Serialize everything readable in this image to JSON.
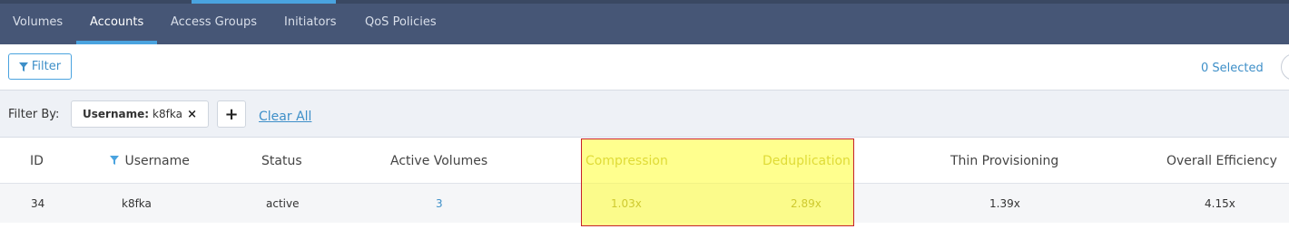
{
  "nav": {
    "tabs": [
      {
        "label": "Volumes"
      },
      {
        "label": "Accounts",
        "active": true
      },
      {
        "label": "Access Groups"
      },
      {
        "label": "Initiators"
      },
      {
        "label": "QoS Policies"
      }
    ],
    "accent_color": "#4aa3df",
    "background_color": "#465676"
  },
  "toolbar": {
    "filter_label": "Filter",
    "filter_icon": "funnel-icon",
    "selected_text": "0 Selected"
  },
  "filter_bar": {
    "label": "Filter By:",
    "chip": {
      "key": "Username:",
      "value": "k8fka",
      "remove": "×"
    },
    "add_label": "+",
    "clear_label": "Clear All"
  },
  "table": {
    "columns": [
      {
        "label": "ID"
      },
      {
        "label": "Username",
        "filtered": true
      },
      {
        "label": "Status"
      },
      {
        "label": "Active Volumes"
      },
      {
        "label": "Compression",
        "highlighted": true
      },
      {
        "label": "Deduplication",
        "highlighted": true
      },
      {
        "label": "Thin Provisioning"
      },
      {
        "label": "Overall Efficiency"
      }
    ],
    "rows": [
      {
        "id": "34",
        "username": "k8fka",
        "status": "active",
        "active_volumes": "3",
        "compression": "1.03x",
        "deduplication": "2.89x",
        "thin_provisioning": "1.39x",
        "overall_efficiency": "4.15x"
      }
    ]
  },
  "highlight_color": "#ffff3c",
  "highlight_border_color": "#c6202b"
}
